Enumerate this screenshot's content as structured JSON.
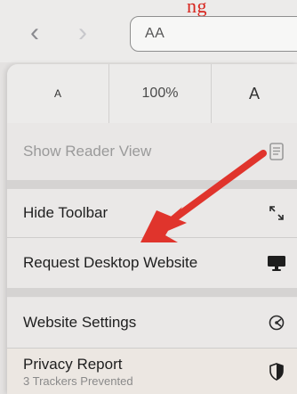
{
  "header": {
    "red_text": "ng",
    "back_symbol": "‹",
    "forward_symbol": "›",
    "aa_button_label": "AA"
  },
  "menu": {
    "font_small_label": "A",
    "zoom_level": "100%",
    "font_large_label": "A",
    "items": [
      {
        "label": "Show Reader View",
        "icon": "reader-view-icon",
        "enabled": false
      },
      {
        "label": "Hide Toolbar",
        "icon": "arrows-diagonal-icon",
        "enabled": true
      },
      {
        "label": "Request Desktop Website",
        "icon": "desktop-monitor-icon",
        "enabled": true
      },
      {
        "label": "Website Settings",
        "icon": "gear-icon",
        "enabled": true
      },
      {
        "label": "Privacy Report",
        "sublabel": "3 Trackers Prevented",
        "icon": "shield-icon",
        "enabled": true
      }
    ]
  },
  "annotation": {
    "arrow_color": "#e0342c",
    "arrow_icon": "annotation-arrow"
  }
}
